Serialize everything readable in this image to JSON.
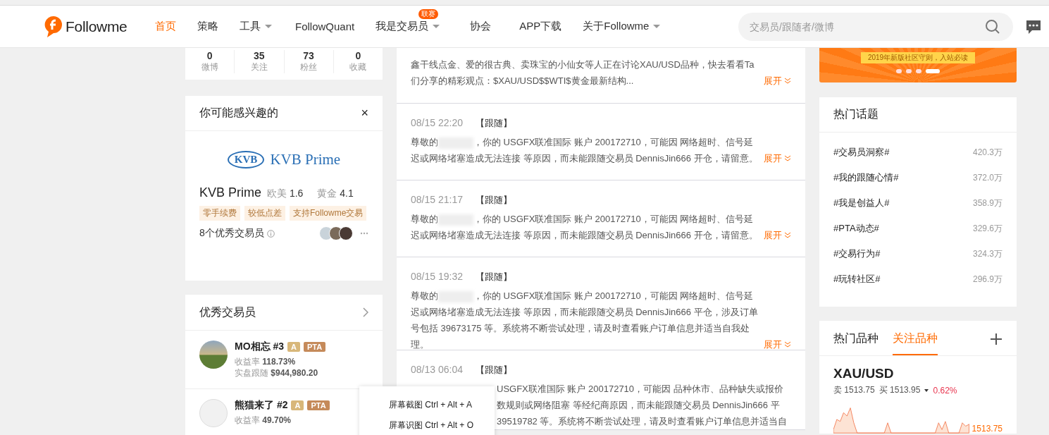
{
  "nav": {
    "logo": "Followme",
    "items": [
      {
        "label": "首页",
        "selected": true,
        "dropdown": false
      },
      {
        "label": "策略",
        "selected": false,
        "dropdown": false
      },
      {
        "label": "工具",
        "selected": false,
        "dropdown": true
      },
      {
        "label": "FollowQuant",
        "selected": false,
        "dropdown": false
      },
      {
        "label": "我是交易员",
        "selected": false,
        "dropdown": true,
        "badge": "联赛"
      },
      {
        "label": "协会",
        "selected": false,
        "dropdown": false
      },
      {
        "label": "APP下载",
        "selected": false,
        "dropdown": false
      },
      {
        "label": "关于Followme",
        "selected": false,
        "dropdown": true
      }
    ],
    "search": {
      "placeholder": "交易员/跟随者/微博"
    }
  },
  "profile_stats": [
    {
      "value": "0",
      "label": "微博"
    },
    {
      "value": "35",
      "label": "关注"
    },
    {
      "value": "73",
      "label": "粉丝"
    },
    {
      "value": "0",
      "label": "收藏"
    }
  ],
  "suggestion": {
    "title": "你可能感兴趣的",
    "close": "×",
    "logo_mark": "KVB",
    "logo_text": "KVB Prime",
    "name": "KVB Prime",
    "metrics": [
      {
        "label": "欧美",
        "value": "1.6"
      },
      {
        "label": "黄金",
        "value": "4.1"
      }
    ],
    "tags": [
      "零手续费",
      "较低点差",
      "支持Followme交易"
    ],
    "traders": "8个优秀交易员"
  },
  "top_traders": {
    "title": "优秀交易员",
    "items": [
      {
        "name": "MO相忘 #3",
        "badges": [
          "A",
          "PTA"
        ],
        "stats": [
          {
            "label": "收益率",
            "value": "118.73%"
          },
          {
            "label": "实盘跟随",
            "value": "$944,980.20"
          }
        ]
      },
      {
        "name": "熊猫来了 #2",
        "badges": [
          "A",
          "PTA"
        ],
        "stats": [
          {
            "label": "收益率",
            "value": "49.70%"
          }
        ]
      }
    ]
  },
  "feed": [
    {
      "text": "鑫干线点金、爱的很古典、卖珠宝的小仙女等人正在讨论XAU/USD品种，快去看看Ta们分享的精彩观点：$XAU/USD$$WTI$黄金最新结构...",
      "expand": "展开"
    },
    {
      "time": "08/15 22:20",
      "tag": "【跟随】",
      "greeting": "尊敬的",
      "blurred": true,
      "text": "，你的 USGFX联准国际 账户 200172710，可能因 网络超时、信号延迟或网络堵塞造成无法连接 等原因，而未能跟随交易员 DennisJin666 开仓，请留意。",
      "expand": "展开"
    },
    {
      "time": "08/15 21:17",
      "tag": "【跟随】",
      "greeting": "尊敬的",
      "blurred": true,
      "text": "，你的 USGFX联准国际 账户 200172710，可能因 网络超时、信号延迟或网络堵塞造成无法连接 等原因，而未能跟随交易员 DennisJin666 开仓，请留意。",
      "expand": "展开"
    },
    {
      "time": "08/15 19:32",
      "tag": "【跟随】",
      "greeting": "尊敬的",
      "blurred": true,
      "text": "，你的 USGFX联准国际 账户 200172710，可能因 网络超时、信号延迟或网络堵塞造成无法连接 等原因，而未能跟随交易员 DennisJin666 平仓，涉及订单号包括 39673175 等。系统将不断尝试处理，请及时查看账户订单信息并适当自我处理。",
      "expand": "展开"
    },
    {
      "time": "08/13 06:04",
      "tag": "【跟随】",
      "lines": [
        "USGFX联准国际 账户 200172710，可能因 品种休市、品种缺失或报价",
        "数规则或网络阻塞 等经纪商原因，而未能跟随交易员 DennisJin666 平",
        "39519782 等。系统将不断尝试处理，请及时查看账户订单信息并适当自"
      ]
    }
  ],
  "banner": {
    "text": "2019年新版社区守则，入站必读"
  },
  "hot_topics": {
    "title": "热门话题",
    "items": [
      {
        "label": "#交易员洞察#",
        "count": "420.3万"
      },
      {
        "label": "#我的跟随心情#",
        "count": "372.0万"
      },
      {
        "label": "#我是创益人#",
        "count": "358.9万"
      },
      {
        "label": "#PTA动态#",
        "count": "329.6万"
      },
      {
        "label": "#交易行为#",
        "count": "324.3万"
      },
      {
        "label": "#玩转社区#",
        "count": "296.9万"
      }
    ]
  },
  "markets": {
    "tabs": [
      {
        "label": "热门品种",
        "selected": false
      },
      {
        "label": "关注品种",
        "selected": true
      }
    ],
    "symbol": "XAU/USD",
    "sell_label": "卖",
    "sell": "1513.75",
    "buy_label": "买",
    "buy": "1513.95",
    "change": "0.62%",
    "last_price": "1513.75"
  },
  "context_menu": [
    "屏幕截图 Ctrl + Alt + A",
    "屏幕识图 Ctrl + Alt + O"
  ]
}
